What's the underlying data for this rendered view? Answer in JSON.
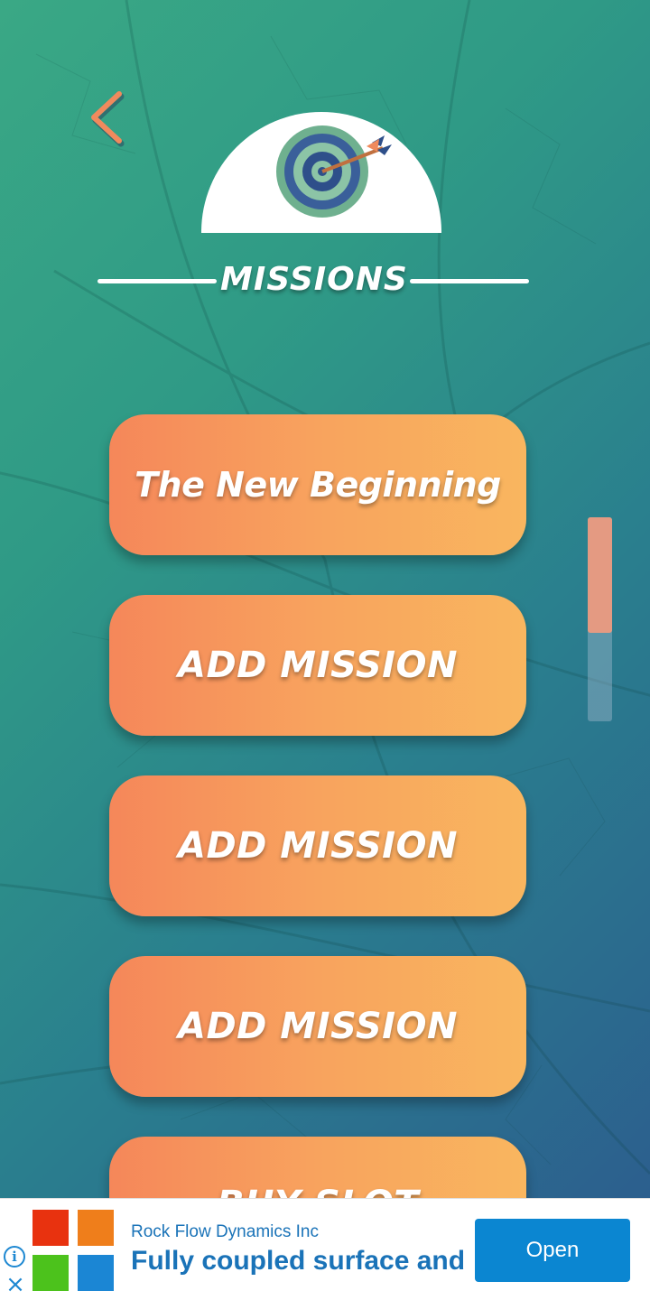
{
  "header": {
    "title": "MISSIONS"
  },
  "icons": {
    "back": "chevron-left-icon",
    "target": "target-arrow-icon"
  },
  "missions": [
    {
      "label": "The New Beginning"
    },
    {
      "label": "ADD MISSION"
    },
    {
      "label": "ADD MISSION"
    },
    {
      "label": "ADD MISSION"
    },
    {
      "label": "BUY SLOT"
    }
  ],
  "scrollbar": {
    "position_fraction": 0.0,
    "visible_fraction": 0.57
  },
  "ad": {
    "advertiser": "Rock Flow Dynamics Inc",
    "headline": "Fully coupled surface and",
    "cta_label": "Open"
  },
  "colors": {
    "accent_orange": "#f5875a",
    "accent_yellow": "#f9b65f",
    "background_green": "#3aa885",
    "background_blue": "#2c5a8e",
    "ad_blue": "#0b86d1"
  }
}
